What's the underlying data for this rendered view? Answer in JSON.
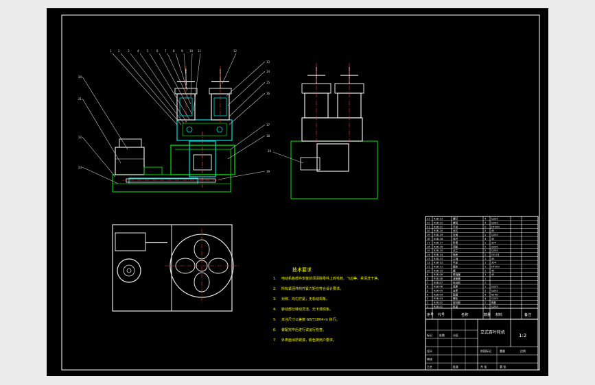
{
  "viewport": {
    "background": "#000000"
  },
  "colors": {
    "frame": "#ffffff",
    "outline_green": "#00c800",
    "part_white": "#e8e8e8",
    "cyan_hatch": "#00e0e0",
    "red_center": "#ff3030",
    "yellow_text": "#ffff00",
    "leader": "#c8c8c8"
  },
  "tech_requirements": {
    "title": "技术要求",
    "items": [
      {
        "num": "1.",
        "text": "电动机各部件安装前须清除零件上的毛刺、飞边等，并清洗干净。"
      },
      {
        "num": "2.",
        "text": "所有紧固件的拧紧力矩应符合设计要求。"
      },
      {
        "num": "3.",
        "text": "对称、均匀拧紧，无松动现象。"
      },
      {
        "num": "4.",
        "text": "转动部分转动灵活，无卡滞现象。"
      },
      {
        "num": "5.",
        "text": "未注尺寸公差按 GB/T1804-m 执行。"
      },
      {
        "num": "6.",
        "text": "装配完毕后进行试运行检查。"
      },
      {
        "num": "7.",
        "text": "外表面涂防锈漆，颜色按用户要求。"
      }
    ]
  },
  "title_block": {
    "drawing_name": "立式百叶轮机",
    "scale": "1:2",
    "header_cols": [
      "序号",
      "代号",
      "名称",
      "数量",
      "材料",
      "备注"
    ],
    "labels": [
      "标记",
      "处数",
      "分区",
      "设计",
      "审核",
      "工艺",
      "批准",
      "阶段标记",
      "重量",
      "比例",
      "共 张",
      "第 张"
    ]
  },
  "bom_rows": [
    [
      "23",
      "RSB-23",
      "螺钉",
      "4",
      "Q235",
      ""
    ],
    [
      "22",
      "RSB-22",
      "螺母",
      "4",
      "Q235",
      ""
    ],
    [
      "21",
      "RSB-21",
      "手轮",
      "2",
      "HT200",
      ""
    ],
    [
      "20",
      "RSB-20",
      "丝杠",
      "2",
      "45",
      ""
    ],
    [
      "19",
      "RSB-19",
      "压盖",
      "2",
      "Q235",
      ""
    ],
    [
      "18",
      "RSB-18",
      "导杆",
      "4",
      "45",
      ""
    ],
    [
      "17",
      "RSB-17",
      "料筒",
      "2",
      "304",
      ""
    ],
    [
      "16",
      "RSB-16",
      "顶板",
      "2",
      "Q235",
      ""
    ],
    [
      "15",
      "RSB-15",
      "法兰",
      "2",
      "Q235",
      ""
    ],
    [
      "14",
      "RSB-14",
      "轴承",
      "2",
      "GCr15",
      ""
    ],
    [
      "13",
      "RSB-13",
      "主轴",
      "1",
      "45",
      ""
    ],
    [
      "12",
      "RSB-12",
      "叶轮",
      "1",
      "304",
      ""
    ],
    [
      "11",
      "RSB-11",
      "箱体",
      "1",
      "HT200",
      ""
    ],
    [
      "10",
      "RSB-10",
      "键",
      "1",
      "45",
      ""
    ],
    [
      "9",
      "RSB-09",
      "联轴器",
      "1",
      "45",
      ""
    ],
    [
      "8",
      "RSB-08",
      "减速器",
      "1",
      "",
      ""
    ],
    [
      "7",
      "RSB-07",
      "电动机",
      "1",
      "",
      ""
    ],
    [
      "6",
      "RSB-06",
      "底座",
      "1",
      "Q235",
      ""
    ],
    [
      "5",
      "RSB-05",
      "支架",
      "2",
      "Q235",
      ""
    ],
    [
      "4",
      "RSB-04",
      "垫圈",
      "4",
      "65Mn",
      ""
    ],
    [
      "3",
      "RSB-03",
      "螺栓",
      "4",
      "Q235",
      ""
    ],
    [
      "2",
      "RSB-02",
      "密封圈",
      "2",
      "橡胶",
      ""
    ],
    [
      "1",
      "RSB-01",
      "机架",
      "1",
      "Q235",
      ""
    ]
  ]
}
